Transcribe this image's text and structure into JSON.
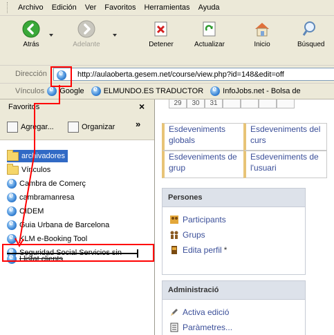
{
  "menubar": {
    "items": [
      "Archivo",
      "Edición",
      "Ver",
      "Favoritos",
      "Herramientas",
      "Ayuda"
    ]
  },
  "toolbar": {
    "back": "Atrás",
    "forward": "Adelante",
    "stop": "Detener",
    "refresh": "Actualizar",
    "home": "Inicio",
    "search": "Búsqued"
  },
  "address": {
    "label": "Dirección",
    "url": "http://aulaoberta.gesem.net/course/view.php?id=148&edit=off"
  },
  "links": {
    "label": "Vínculos",
    "items": [
      "Google",
      "ELMUNDO.ES TRADUCTOR",
      "InfoJobs.net - Bolsa de"
    ]
  },
  "favorites": {
    "title": "Favoritos",
    "close": "×",
    "add": "Agregar...",
    "organize": "Organizar",
    "more": "»",
    "items": [
      {
        "label": "archivadores",
        "type": "folder",
        "selected": true
      },
      {
        "label": "Vínculos",
        "type": "folder"
      },
      {
        "label": "Cambra de Comerç",
        "type": "link"
      },
      {
        "label": "cambramanresa",
        "type": "link"
      },
      {
        "label": "CIDEM",
        "type": "link"
      },
      {
        "label": "Guia Urbana de Barcelona",
        "type": "link"
      },
      {
        "label": "KLM e-Booking Tool",
        "type": "link"
      },
      {
        "label": "Seguridad Social Servicios sin",
        "type": "link"
      },
      {
        "label": "Llistat clients",
        "type": "link"
      }
    ]
  },
  "calendar": {
    "days": [
      "29",
      "30",
      "31"
    ]
  },
  "legend": {
    "global": "Esdeveniments globals",
    "course": "Esdeveniments del curs",
    "group": "Esdeveniments de grup",
    "user": "Esdeveniments de l'usuari"
  },
  "persones": {
    "title": "Persones",
    "items": [
      "Participants",
      "Grups",
      "Edita perfil"
    ],
    "edit_marker": "*"
  },
  "admin": {
    "title": "Administració",
    "items": [
      "Activa edició",
      "Paràmetres..."
    ]
  },
  "colors": {
    "selection": "#316ac5",
    "annotation": "#ff0000",
    "link": "#3b4f99"
  }
}
